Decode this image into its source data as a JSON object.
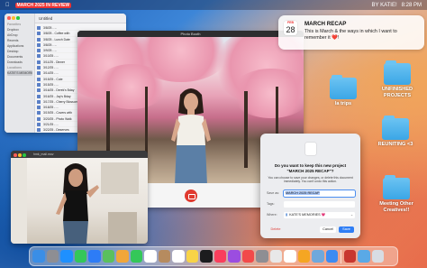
{
  "menubar": {
    "app_name": "MARCH 2025 IN REVIEW",
    "user": "BY KATIE!",
    "time": "8:28 PM"
  },
  "finder": {
    "title": "Untitled",
    "sidebar": [
      "Favorites",
      "Dropbox",
      "AirDrop",
      "Recents",
      "Applications",
      "Desktop",
      "Documents",
      "Downloads",
      "Locations",
      "KATIE'S MEMORIES"
    ],
    "files": [
      "3/8/25 - ...",
      "3/8/25 - Coffee with",
      "3/8/25 - Lunch Date",
      "3/8/25 - ...",
      "3/9/25 - ...",
      "3/10/25 - ...",
      "3/11/25 - Dinner",
      "3/12/25 - ...",
      "3/14/25 - ...",
      "3/15/25 - Cute",
      "3/15/25 - ...",
      "3/16/25 - Derek's Bday",
      "3/16/25 - Jay's Bday",
      "3/17/25 - Cherry Blossom",
      "3/18/25 - ...",
      "3/19/25 - Covers with",
      "3/20/25 - Photo Walk",
      "3/21/25 - ...",
      "3/22/25 - Deserves",
      "3/23/25 - Anne Day",
      "3/24/25 - Japanese",
      "3/25/25 - ...",
      "3/26/25 - Rest Day",
      "3/27/25 - ...",
      "3/28/25 - ..."
    ]
  },
  "photobooth": {
    "title": "Photo Booth"
  },
  "quicktime": {
    "title": "hmk_mail.mov"
  },
  "notification": {
    "month": "FEB",
    "day": "28",
    "title": "MARCH RECAP",
    "body": "This is March & the ways in which I want to remember it ❤️!"
  },
  "desktop": {
    "folders": [
      {
        "label": "la trips"
      },
      {
        "label": "UNFINISHED PROJECTS"
      },
      {
        "label": "REUNITING <3"
      },
      {
        "label": "Meeting Other Creatives!!"
      }
    ]
  },
  "dialog": {
    "question": "Do you want to keep this new project \"MARCH 2025 RECAP\"?",
    "subtext": "You can choose to save your changes, or delete this document immediately. You can't undo this action.",
    "save_as_label": "Save as:",
    "save_as_value": "MARCH 2025 RECAP",
    "tags_label": "Tags:",
    "where_label": "Where:",
    "where_value": "KATE'S MEMORIES 💗",
    "delete_label": "Delete",
    "cancel_label": "Cancel",
    "save_label": "Save"
  },
  "dock": {
    "apps": [
      "finder-icon",
      "launchpad-icon",
      "safari-icon",
      "messages-icon",
      "mail-icon",
      "maps-icon",
      "photos-icon",
      "facetime-icon",
      "calendar-icon",
      "contacts-icon",
      "reminders-icon",
      "notes-icon",
      "tv-icon",
      "music-icon",
      "podcasts-icon",
      "news-icon",
      "settings-icon",
      "chrome-icon",
      "notion-icon",
      "pages-icon",
      "preview-icon",
      "keynote-icon",
      "photobooth-icon",
      "downloads-icon",
      "trash-icon"
    ],
    "colors": [
      "#3a8ee6",
      "#8e8e93",
      "#1e90ff",
      "#34c759",
      "#2d7cf6",
      "#5ac05e",
      "#f0a63a",
      "#34c759",
      "#ffffff",
      "#b68b5f",
      "#ffffff",
      "#f8d347",
      "#1c1c1e",
      "#fa3e5c",
      "#9b4de0",
      "#f24a4a",
      "#8e8e93",
      "#e8e8e8",
      "#ffffff",
      "#f5a623",
      "#6fa8dc",
      "#3d8bf2",
      "#c8372f",
      "#5aa9e6",
      "#d8dde3"
    ]
  }
}
